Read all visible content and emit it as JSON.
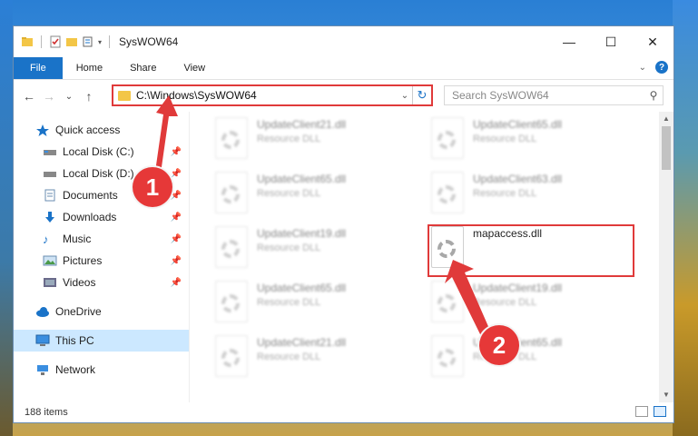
{
  "window": {
    "title": "SysWOW64",
    "minimize": "—",
    "maximize": "☐",
    "close": "✕"
  },
  "ribbon": {
    "tabs": [
      "File",
      "Home",
      "Share",
      "View"
    ]
  },
  "nav": {
    "back": "←",
    "forward": "→",
    "recent": "⌄",
    "up": "↑"
  },
  "address": {
    "path": "C:\\Windows\\SysWOW64",
    "refresh": "↻",
    "dropdown": "⌄"
  },
  "search": {
    "placeholder": "Search SysWOW64",
    "icon": "⚲"
  },
  "sidebar": {
    "items": [
      {
        "label": "Quick access",
        "icon": "star-icon"
      },
      {
        "label": "Local Disk (C:)",
        "icon": "drive-icon",
        "pinned": true
      },
      {
        "label": "Local Disk (D:)",
        "icon": "drive-icon",
        "pinned": true
      },
      {
        "label": "Documents",
        "icon": "documents-icon",
        "pinned": true
      },
      {
        "label": "Downloads",
        "icon": "download-icon",
        "pinned": true
      },
      {
        "label": "Music",
        "icon": "music-icon",
        "pinned": true
      },
      {
        "label": "Pictures",
        "icon": "pictures-icon",
        "pinned": true
      },
      {
        "label": "Videos",
        "icon": "videos-icon",
        "pinned": true
      },
      {
        "label": "OneDrive",
        "icon": "cloud-icon"
      },
      {
        "label": "This PC",
        "icon": "computer-icon",
        "selected": true
      },
      {
        "label": "Network",
        "icon": "network-icon"
      }
    ]
  },
  "files": {
    "left": [
      {
        "name": "UpdateClient21.dll",
        "type": "Resource DLL"
      },
      {
        "name": "UpdateClient65.dll",
        "type": "Resource DLL"
      },
      {
        "name": "UpdateClient19.dll",
        "type": "Resource DLL"
      },
      {
        "name": "UpdateClient65.dll",
        "type": "Resource DLL"
      },
      {
        "name": "UpdateClient21.dll",
        "type": "Resource DLL"
      }
    ],
    "right": [
      {
        "name": "UpdateClient65.dll",
        "type": "Resource DLL"
      },
      {
        "name": "UpdateClient63.dll",
        "type": "Resource DLL"
      },
      {
        "name": "mapaccess.dll",
        "type": ""
      },
      {
        "name": "UpdateClient19.dll",
        "type": "Resource DLL"
      },
      {
        "name": "UpdateClient65.dll",
        "type": "Resource DLL"
      }
    ]
  },
  "status": {
    "count": "188 items"
  },
  "annotations": {
    "step1": "1",
    "step2": "2",
    "color": "#e03a3a"
  }
}
